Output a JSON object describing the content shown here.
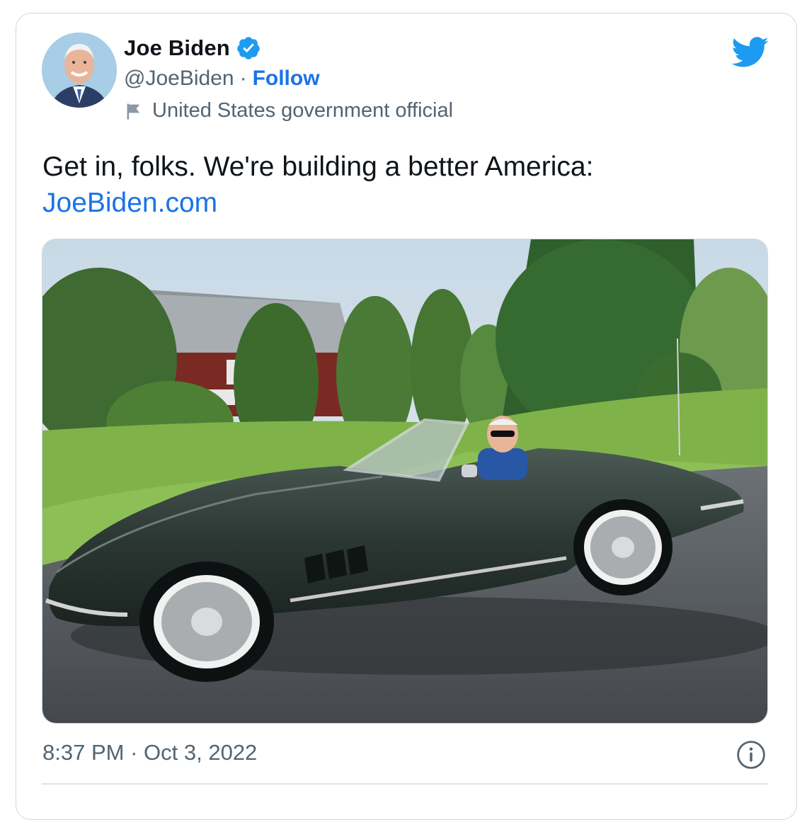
{
  "author": {
    "name": "Joe Biden",
    "handle": "@JoeBiden",
    "separator": "·",
    "follow_label": "Follow",
    "account_label": "United States government official",
    "verified_icon": "verified-badge-icon",
    "label_icon": "flag-icon"
  },
  "tweet": {
    "text": "Get in, folks. We're building a better America:",
    "link": "JoeBiden.com"
  },
  "media": {
    "description": "photo-man-in-green-convertible"
  },
  "footer": {
    "time": "8:37 PM",
    "separator": "·",
    "date": "Oct 3, 2022",
    "info_icon": "info-icon"
  },
  "colors": {
    "twitter_blue": "#1d9bf0",
    "link_blue": "#1a73e8",
    "secondary_text": "#536471",
    "border": "#cfd9de"
  }
}
